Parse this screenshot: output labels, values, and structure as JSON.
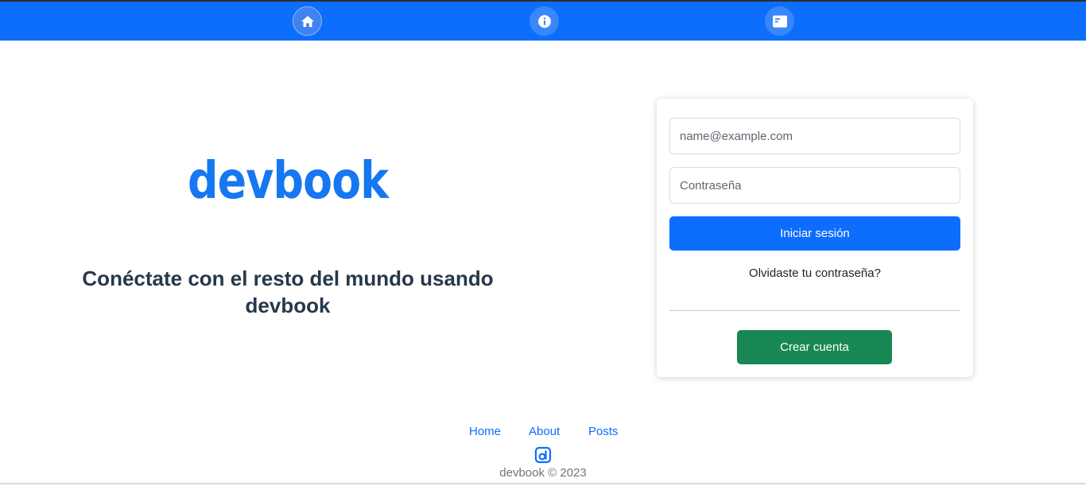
{
  "nav": {
    "items": [
      {
        "name": "home",
        "icon": "home-icon"
      },
      {
        "name": "about",
        "icon": "info-icon"
      },
      {
        "name": "posts",
        "icon": "posts-icon"
      }
    ]
  },
  "hero": {
    "brand": "devbook",
    "tagline": "Conéctate con el resto del mundo usando devbook"
  },
  "login": {
    "email_placeholder": "name@example.com",
    "email_value": "",
    "password_placeholder": "Contraseña",
    "password_value": "",
    "login_label": "Iniciar sesión",
    "forgot_label": "Olvidaste tu contraseña?",
    "create_label": "Crear cuenta"
  },
  "footer": {
    "links": [
      "Home",
      "About",
      "Posts"
    ],
    "logo_icon": "devbook-logo-icon",
    "copyright": "devbook © 2023"
  },
  "colors": {
    "primary": "#0d6efd",
    "success": "#198754",
    "brand": "#1677f0",
    "heading": "#27384a",
    "muted": "#6c757d"
  }
}
